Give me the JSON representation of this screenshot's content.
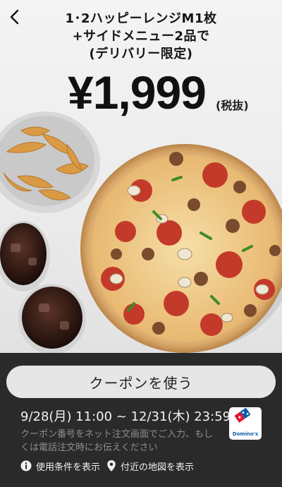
{
  "header": {
    "back_icon": "chevron-left-icon",
    "title_lines": [
      "1･2ハッピーレンジM1枚",
      "+サイドメニュー2品で",
      "(デリバリー限定)"
    ]
  },
  "offer": {
    "price": "¥1,999",
    "tax_note": "(税抜)"
  },
  "coupon": {
    "use_button_label": "クーポンを使う",
    "period": "9/28(月) 11:00 ~ 12/31(木) 23:59",
    "note": "クーポン番号をネット注文画面でご入力、もしくは電話注文時にお伝えください",
    "brand_name": "Domino's",
    "brand_color_blue": "#0b5ba6",
    "brand_color_red": "#e31837"
  },
  "links": {
    "terms_label": "使用条件を表示",
    "terms_icon": "info-icon",
    "map_label": "付近の地図を表示",
    "map_icon": "map-pin-icon"
  }
}
